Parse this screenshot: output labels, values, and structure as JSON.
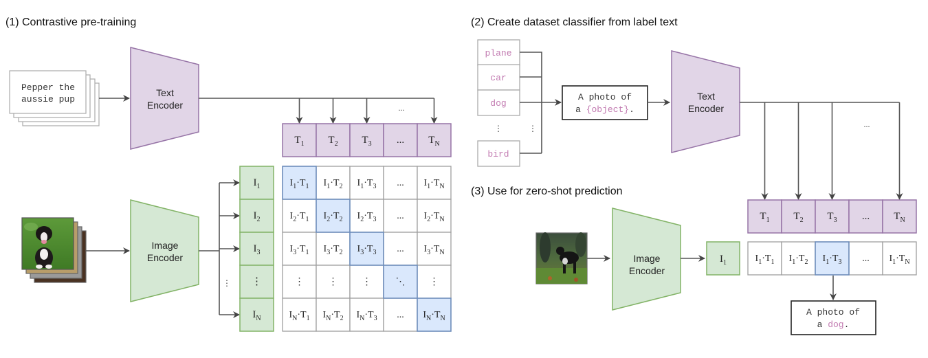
{
  "sections": {
    "pretraining": {
      "title": "(1) Contrastive pre-training"
    },
    "classifier": {
      "title": "(2) Create dataset classifier from label text"
    },
    "zeroshot": {
      "title": "(3) Use for zero-shot prediction"
    }
  },
  "pretraining": {
    "text_input": [
      "Pepper the",
      "aussie pup"
    ],
    "text_encoder": [
      "Text",
      "Encoder"
    ],
    "image_encoder": [
      "Image",
      "Encoder"
    ],
    "image_input": "puppy-photo-stack",
    "text_embeddings": [
      {
        "base": "T",
        "sub": "1"
      },
      {
        "base": "T",
        "sub": "2"
      },
      {
        "base": "T",
        "sub": "3"
      },
      {
        "base": "...",
        "sub": ""
      },
      {
        "base": "T",
        "sub": "N"
      }
    ],
    "image_embeddings": [
      {
        "base": "I",
        "sub": "1"
      },
      {
        "base": "I",
        "sub": "2"
      },
      {
        "base": "I",
        "sub": "3"
      },
      {
        "base": "⋮",
        "sub": ""
      },
      {
        "base": "I",
        "sub": "N"
      }
    ],
    "fanout_ellipsis": "...",
    "image_fanout_ellipsis": "⋮",
    "matrix": [
      [
        {
          "i": "1",
          "t": "1",
          "hl": true
        },
        {
          "i": "1",
          "t": "2"
        },
        {
          "i": "1",
          "t": "3"
        },
        {
          "txt": "..."
        },
        {
          "i": "1",
          "t": "N"
        }
      ],
      [
        {
          "i": "2",
          "t": "1"
        },
        {
          "i": "2",
          "t": "2",
          "hl": true
        },
        {
          "i": "2",
          "t": "3"
        },
        {
          "txt": "..."
        },
        {
          "i": "2",
          "t": "N"
        }
      ],
      [
        {
          "i": "3",
          "t": "1"
        },
        {
          "i": "3",
          "t": "2"
        },
        {
          "i": "3",
          "t": "3",
          "hl": true
        },
        {
          "txt": "..."
        },
        {
          "i": "3",
          "t": "N"
        }
      ],
      [
        {
          "txt": "⋮"
        },
        {
          "txt": "⋮"
        },
        {
          "txt": "⋮"
        },
        {
          "txt": "⋱",
          "hl": true
        },
        {
          "txt": "⋮"
        }
      ],
      [
        {
          "i": "N",
          "t": "1"
        },
        {
          "i": "N",
          "t": "2"
        },
        {
          "i": "N",
          "t": "3"
        },
        {
          "txt": "..."
        },
        {
          "i": "N",
          "t": "N",
          "hl": true
        }
      ]
    ]
  },
  "classifier": {
    "labels": [
      "plane",
      "car",
      "dog",
      "bird"
    ],
    "label_ellipsis": "⋮",
    "template_line1": "A photo of",
    "template_line2_prefix": "a ",
    "template_placeholder": "{object}",
    "template_line2_suffix": ".",
    "text_encoder": [
      "Text",
      "Encoder"
    ],
    "fanout_ellipsis": "..."
  },
  "zeroshot": {
    "image_input": "dog-photo",
    "image_encoder": [
      "Image",
      "Encoder"
    ],
    "image_embedding": {
      "base": "I",
      "sub": "1"
    },
    "text_embeddings": [
      {
        "base": "T",
        "sub": "1"
      },
      {
        "base": "T",
        "sub": "2"
      },
      {
        "base": "T",
        "sub": "3"
      },
      {
        "base": "...",
        "sub": ""
      },
      {
        "base": "T",
        "sub": "N"
      }
    ],
    "scores": [
      {
        "i": "1",
        "t": "1"
      },
      {
        "i": "1",
        "t": "2"
      },
      {
        "i": "1",
        "t": "3",
        "hl": true
      },
      {
        "txt": "..."
      },
      {
        "i": "1",
        "t": "N"
      }
    ],
    "prediction_line1": "A photo of",
    "prediction_line2_prefix": "a ",
    "prediction_word": "dog",
    "prediction_line2_suffix": "."
  },
  "colors": {
    "text_fill": "#e1d5e7",
    "text_stroke": "#9673a6",
    "image_fill": "#d5e8d4",
    "image_stroke": "#82b366",
    "highlight_fill": "#dae8fc",
    "highlight_stroke": "#6c8ebf",
    "cell_stroke": "#9e9e9e",
    "label_pink": "#c27bb1"
  }
}
